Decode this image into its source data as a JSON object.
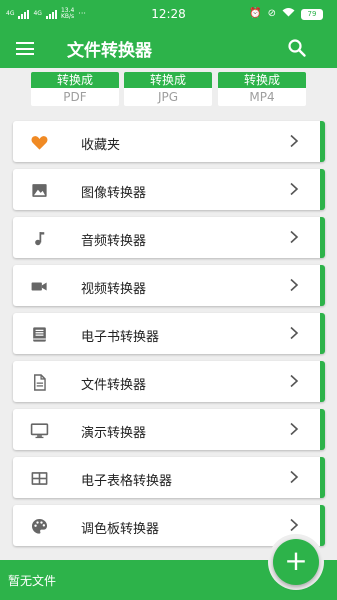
{
  "status_bar": {
    "carrier_1": "4G",
    "carrier_2": "4G",
    "speed": "13.4",
    "speed_unit": "KB/s",
    "time": "12:28",
    "battery": "79"
  },
  "app_bar": {
    "title": "文件转换器",
    "menu_icon": "hamburger-menu",
    "search_icon": "search"
  },
  "quick_convert": [
    {
      "label": "转换成",
      "format": "PDF"
    },
    {
      "label": "转换成",
      "format": "JPG"
    },
    {
      "label": "转换成",
      "format": "MP4"
    }
  ],
  "converters": [
    {
      "label": "收藏夹",
      "icon": "heart"
    },
    {
      "label": "图像转换器",
      "icon": "image"
    },
    {
      "label": "音频转换器",
      "icon": "music-note"
    },
    {
      "label": "视频转换器",
      "icon": "video-camera"
    },
    {
      "label": "电子书转换器",
      "icon": "book"
    },
    {
      "label": "文件转换器",
      "icon": "document"
    },
    {
      "label": "演示转换器",
      "icon": "monitor"
    },
    {
      "label": "电子表格转换器",
      "icon": "table"
    },
    {
      "label": "调色板转换器",
      "icon": "palette"
    }
  ],
  "bottom": {
    "empty_text": "暂无文件",
    "fab_label": "+"
  },
  "colors": {
    "primary": "#2db34a",
    "heart": "#f08a24",
    "icon_gray": "#666666",
    "background": "#eeeeee"
  }
}
